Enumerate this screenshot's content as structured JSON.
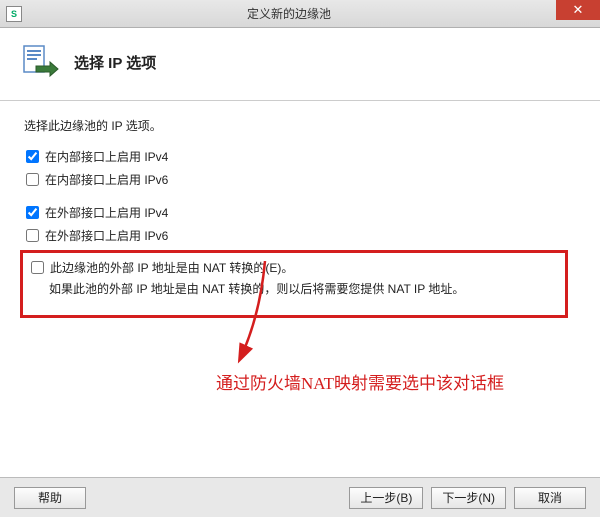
{
  "titlebar": {
    "icon_label": "S",
    "title": "定义新的边缘池",
    "close_label": "✕"
  },
  "header": {
    "title": "选择 IP 选项"
  },
  "content": {
    "instruction": "选择此边缘池的 IP 选项。",
    "checks": {
      "internal_ipv4": {
        "label": "在内部接口上启用 IPv4",
        "checked": true
      },
      "internal_ipv6": {
        "label": "在内部接口上启用 IPv6",
        "checked": false
      },
      "external_ipv4": {
        "label": "在外部接口上启用 IPv4",
        "checked": true
      },
      "external_ipv6": {
        "label": "在外部接口上启用 IPv6",
        "checked": false
      },
      "nat": {
        "label": "此边缘池的外部 IP 地址是由 NAT 转换的(E)。",
        "checked": false
      }
    },
    "nat_note": "如果此池的外部 IP 地址是由 NAT 转换的，则以后将需要您提供 NAT IP 地址。",
    "annotation": "通过防火墙NAT映射需要选中该对话框"
  },
  "footer": {
    "help": "帮助",
    "back": "上一步(B)",
    "next": "下一步(N)",
    "cancel": "取消"
  }
}
